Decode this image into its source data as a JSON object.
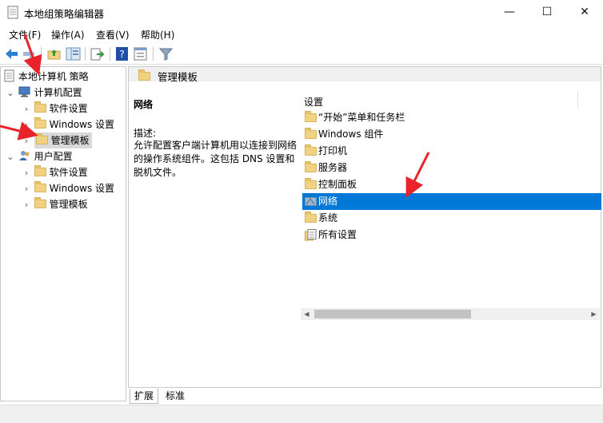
{
  "window": {
    "title": "本地组策略编辑器",
    "controls": {
      "minimize": "—",
      "maximize": "☐",
      "close": "✕"
    }
  },
  "menu": [
    {
      "label": "文件(F)"
    },
    {
      "label": "操作(A)"
    },
    {
      "label": "查看(V)"
    },
    {
      "label": "帮助(H)"
    }
  ],
  "toolbar": {
    "icons": [
      "back-icon",
      "forward-icon",
      "up-folder-icon",
      "show-hide-tree-icon",
      "export-list-icon",
      "help-icon",
      "properties-icon",
      "filter-icon"
    ]
  },
  "tree": {
    "root": "本地计算机 策略",
    "computer_config": "计算机配置",
    "computer_children": [
      "软件设置",
      "Windows 设置",
      "管理模板"
    ],
    "user_config": "用户配置",
    "user_children": [
      "软件设置",
      "Windows 设置",
      "管理模板"
    ]
  },
  "right": {
    "header": "管理模板",
    "description": {
      "title": "网络",
      "label": "描述:",
      "text": "允许配置客户端计算机用以连接到网络的操作系统组件。这包括 DNS 设置和脱机文件。"
    },
    "list_header": "设置",
    "items": [
      {
        "label": "“开始”菜单和任务栏",
        "icon": "folder-icon"
      },
      {
        "label": "Windows 组件",
        "icon": "folder-icon"
      },
      {
        "label": "打印机",
        "icon": "folder-icon"
      },
      {
        "label": "服务器",
        "icon": "folder-icon"
      },
      {
        "label": "控制面板",
        "icon": "folder-icon"
      },
      {
        "label": "网络",
        "icon": "network-folder-icon",
        "selected": true
      },
      {
        "label": "系统",
        "icon": "folder-icon"
      },
      {
        "label": "所有设置",
        "icon": "all-settings-icon"
      }
    ]
  },
  "tabs": [
    {
      "label": "扩展",
      "active": true
    },
    {
      "label": "标准",
      "active": false
    }
  ],
  "colors": {
    "selection": "#0078d7",
    "annotation_arrow": "#e8232a",
    "folder": "#f1d283"
  }
}
